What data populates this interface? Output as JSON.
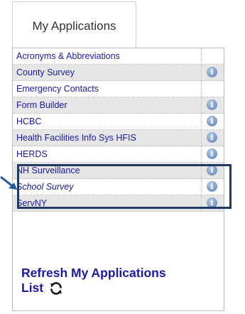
{
  "tab": {
    "label": "My Applications"
  },
  "applications": [
    {
      "name": "Acronyms & Abbreviations",
      "info": false,
      "shaded": false,
      "italic": false
    },
    {
      "name": "County Survey",
      "info": true,
      "shaded": true,
      "italic": false
    },
    {
      "name": "Emergency Contacts",
      "info": false,
      "shaded": false,
      "italic": false
    },
    {
      "name": "Form Builder",
      "info": true,
      "shaded": true,
      "italic": false
    },
    {
      "name": "HCBC",
      "info": true,
      "shaded": false,
      "italic": false
    },
    {
      "name": "Health Facilities Info Sys HFIS",
      "info": true,
      "shaded": true,
      "italic": false
    },
    {
      "name": "HERDS",
      "info": true,
      "shaded": false,
      "italic": false
    },
    {
      "name": "NH Surveillance",
      "info": true,
      "shaded": true,
      "italic": false
    },
    {
      "name": "School Survey",
      "info": true,
      "shaded": false,
      "italic": true
    },
    {
      "name": "ServNY",
      "info": true,
      "shaded": true,
      "italic": false
    }
  ],
  "info_icon": {
    "glyph": "i",
    "icon_name": "info-icon"
  },
  "refresh": {
    "line1": "Refresh My Applications",
    "line2": "List",
    "icon_name": "refresh-icon"
  },
  "colors": {
    "link": "#1a1aa6",
    "highlight_border": "#1f3a63",
    "shaded_row": "#e6e6e6"
  }
}
